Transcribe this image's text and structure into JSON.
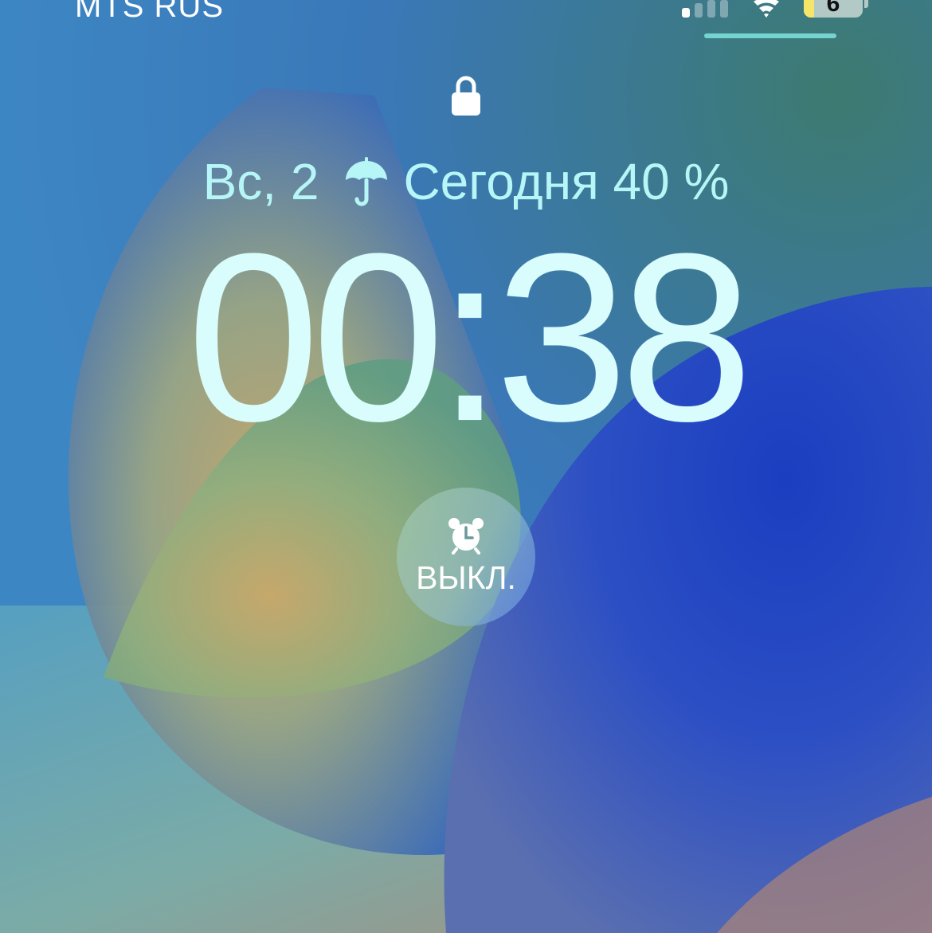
{
  "status_bar": {
    "carrier": "MTS RUS",
    "signal_bars_active": 1,
    "signal_bars_total": 4,
    "wifi_icon": "wifi-icon",
    "battery_level": "6",
    "battery_fraction": 0.06,
    "battery_color": "#f5e66a"
  },
  "lock_icon": "lock-icon",
  "date_line": {
    "date": "Вс, 2",
    "weather_icon": "umbrella-icon",
    "weather_text": "Сегодня 40 %"
  },
  "clock": {
    "time": "00:38"
  },
  "alarm_widget": {
    "icon": "alarm-clock-icon",
    "label": "ВЫКЛ."
  },
  "colors": {
    "text_accent": "#b6f6f6",
    "clock_text": "#d9fdfd",
    "wallpaper_blue": "#1a3fc0"
  }
}
